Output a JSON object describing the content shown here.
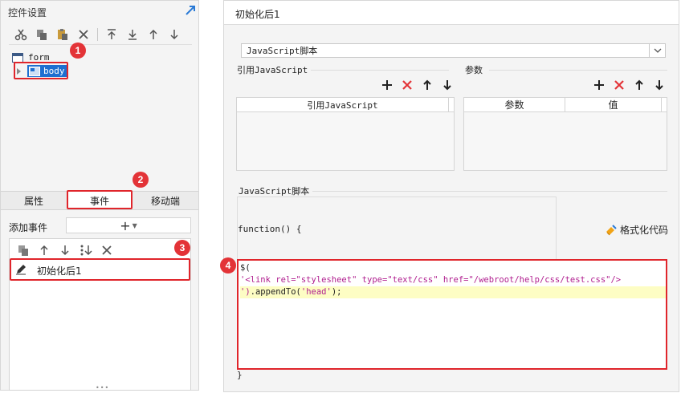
{
  "left_panel": {
    "title": "控件设置",
    "toolbar_icons": [
      "cut-icon",
      "copy-icon",
      "paste-icon",
      "delete-icon",
      "move-top-icon",
      "move-bottom-icon",
      "move-up-icon",
      "move-down-icon"
    ],
    "tree": {
      "root": "form",
      "child": "body"
    },
    "tabs": [
      "属性",
      "事件",
      "移动端"
    ],
    "active_tab": "事件",
    "add_event_label": "添加事件",
    "add_event_symbol": "+",
    "event_toolbar_icons": [
      "copy-icon",
      "move-up-icon",
      "move-down-icon",
      "sort-icon",
      "delete-icon"
    ],
    "events": [
      "初始化后1"
    ]
  },
  "badges": {
    "b1": "1",
    "b2": "2",
    "b3": "3",
    "b4": "4"
  },
  "right_panel": {
    "title": "初始化后1",
    "script_type": "JavaScript脚本",
    "ref_js_label": "引用JavaScript",
    "params_label": "参数",
    "ref_js_column": "引用JavaScript",
    "params_columns": [
      "参数",
      "值"
    ],
    "script_section_label": "JavaScript脚本",
    "function_signature": "function() {",
    "format_label": "格式化代码",
    "code": {
      "line1": "$(",
      "line2": "'<link rel=\"stylesheet\" type=\"text/css\" href=\"/webroot/help/css/test.css\"/>",
      "line3_str": "')",
      "line3_rest": ".appendTo(",
      "line3_arg": "'head'",
      "line3_end": ");"
    },
    "closing_brace": "}"
  },
  "colors": {
    "accent": "#1e6fd0",
    "highlight_red": "#e0252b",
    "delete_red": "#e33337",
    "string_color": "#b01e8f",
    "line_highlight": "#fdfdc4"
  }
}
